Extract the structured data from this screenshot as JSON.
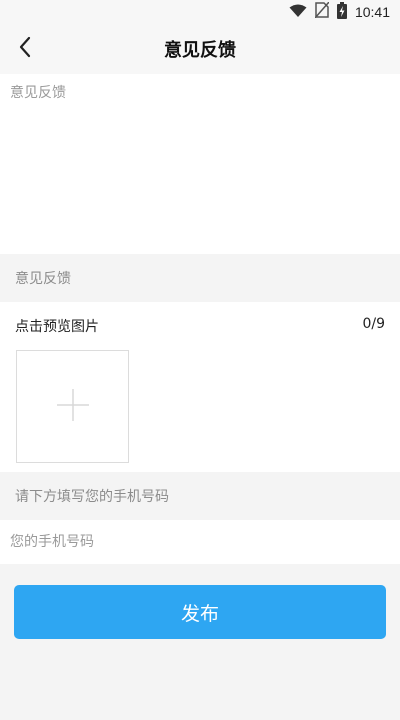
{
  "status_bar": {
    "time": "10:41",
    "icons": [
      "wifi-icon",
      "no-sim-icon",
      "battery-charging-icon"
    ]
  },
  "header": {
    "title": "意见反馈",
    "back_icon": "chevron-left-icon"
  },
  "feedback": {
    "placeholder": "意见反馈",
    "value": ""
  },
  "section_feedback_label": "意见反馈",
  "photos": {
    "title": "点击预览图片",
    "count": "0/9",
    "add_icon": "plus-icon"
  },
  "section_phone_label": "请下方填写您的手机号码",
  "phone": {
    "placeholder": "您的手机号码",
    "value": ""
  },
  "submit_label": "发布",
  "colors": {
    "accent": "#2ea6f2",
    "background": "#f4f4f4",
    "card": "#ffffff"
  }
}
